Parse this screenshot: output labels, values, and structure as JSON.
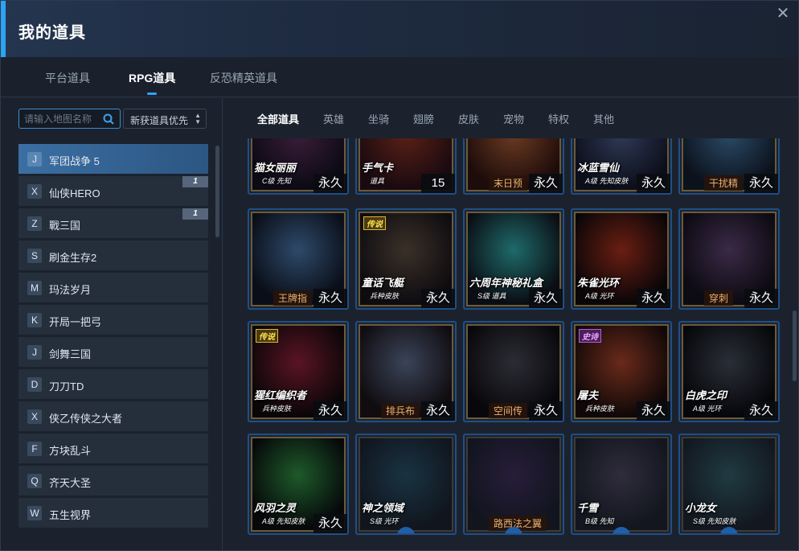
{
  "window": {
    "title": "我的道具",
    "close_icon": "close-icon"
  },
  "top_tabs": [
    {
      "label": "平台道具",
      "active": false
    },
    {
      "label": "RPG道具",
      "active": true
    },
    {
      "label": "反恐精英道具",
      "active": false
    }
  ],
  "search": {
    "placeholder": "请输入地图名称",
    "value": "",
    "icon": "search-icon"
  },
  "sort": {
    "label": "新获道具优先",
    "icon": "sort-arrows-icon"
  },
  "maps": [
    {
      "letter": "J",
      "name": "军团战争 5",
      "badge": "",
      "active": true
    },
    {
      "letter": "X",
      "name": "仙侠HERO",
      "badge": "1",
      "active": false
    },
    {
      "letter": "Z",
      "name": "戰三国",
      "badge": "1",
      "active": false
    },
    {
      "letter": "S",
      "name": "刷金生存2",
      "badge": "",
      "active": false
    },
    {
      "letter": "M",
      "name": "玛法岁月",
      "badge": "",
      "active": false
    },
    {
      "letter": "K",
      "name": "开局一把弓",
      "badge": "",
      "active": false
    },
    {
      "letter": "J",
      "name": "剑舞三国",
      "badge": "",
      "active": false
    },
    {
      "letter": "D",
      "name": "刀刀TD",
      "badge": "",
      "active": false
    },
    {
      "letter": "X",
      "name": "侠乙传侠之大者",
      "badge": "",
      "active": false
    },
    {
      "letter": "F",
      "name": "方块乱斗",
      "badge": "",
      "active": false
    },
    {
      "letter": "Q",
      "name": "齐天大圣",
      "badge": "",
      "active": false
    },
    {
      "letter": "W",
      "name": "五生视界",
      "badge": "",
      "active": false
    }
  ],
  "categories": [
    {
      "label": "全部道具",
      "active": true
    },
    {
      "label": "英雄",
      "active": false
    },
    {
      "label": "坐骑",
      "active": false
    },
    {
      "label": "翅膀",
      "active": false
    },
    {
      "label": "皮肤",
      "active": false
    },
    {
      "label": "宠物",
      "active": false
    },
    {
      "label": "特权",
      "active": false
    },
    {
      "label": "其他",
      "active": false
    }
  ],
  "rows": [
    [
      {
        "name": "猫女丽丽",
        "sub": "C级 先知",
        "plate": "",
        "dur": "永久",
        "tag": "",
        "locked": false,
        "colors": [
          "#3a1d3a",
          "#0c0a14"
        ]
      },
      {
        "name": "手气卡",
        "sub": "道具",
        "plate": "",
        "dur": "15",
        "tag": "",
        "locked": false,
        "colors": [
          "#5a2016",
          "#1a0a10"
        ]
      },
      {
        "name": "",
        "sub": "",
        "plate": "末日预",
        "dur": "永久",
        "tag": "",
        "locked": false,
        "colors": [
          "#6a3a22",
          "#1e0c0a"
        ]
      },
      {
        "name": "冰蓝雪仙",
        "sub": "A级 先知皮肤",
        "plate": "",
        "dur": "永久",
        "tag": "",
        "locked": false,
        "colors": [
          "#2f3a56",
          "#0c0e1a"
        ]
      },
      {
        "name": "",
        "sub": "",
        "plate": "干扰精",
        "dur": "永久",
        "tag": "",
        "locked": false,
        "colors": [
          "#2a4a66",
          "#0c121c"
        ]
      }
    ],
    [
      {
        "name": "",
        "sub": "",
        "plate": "王牌指",
        "dur": "永久",
        "tag": "",
        "locked": false,
        "colors": [
          "#2e4a6a",
          "#0a0e18"
        ]
      },
      {
        "name": "童话飞艇",
        "sub": "兵种皮肤",
        "plate": "",
        "dur": "永久",
        "tag": "传说",
        "locked": false,
        "colors": [
          "#3a3028",
          "#0e0c10"
        ]
      },
      {
        "name": "六周年神秘礼盒",
        "sub": "S级 道具",
        "plate": "",
        "dur": "永久",
        "tag": "",
        "locked": false,
        "colors": [
          "#1f6a6a",
          "#0a0e14"
        ]
      },
      {
        "name": "朱雀光环",
        "sub": "A级 光环",
        "plate": "",
        "dur": "永久",
        "tag": "",
        "locked": false,
        "colors": [
          "#6a1e12",
          "#0a0608"
        ]
      },
      {
        "name": "",
        "sub": "",
        "plate": "穿刺",
        "dur": "永久",
        "tag": "",
        "locked": false,
        "colors": [
          "#3a2a46",
          "#0c0a12"
        ]
      }
    ],
    [
      {
        "name": "猩红编织者",
        "sub": "兵种皮肤",
        "plate": "",
        "dur": "永久",
        "tag": "传说",
        "locked": false,
        "colors": [
          "#5a1424",
          "#0a0608"
        ]
      },
      {
        "name": "",
        "sub": "",
        "plate": "排兵布",
        "dur": "永久",
        "tag": "",
        "locked": false,
        "colors": [
          "#3a4458",
          "#100c10"
        ]
      },
      {
        "name": "",
        "sub": "",
        "plate": "空间传",
        "dur": "永久",
        "tag": "",
        "locked": false,
        "colors": [
          "#2c2c34",
          "#08080c"
        ]
      },
      {
        "name": "屠夫",
        "sub": "兵种皮肤",
        "plate": "",
        "dur": "永久",
        "tag": "史诗",
        "locked": false,
        "colors": [
          "#6a2a1a",
          "#100808"
        ]
      },
      {
        "name": "白虎之印",
        "sub": "A级 光环",
        "plate": "",
        "dur": "永久",
        "tag": "",
        "locked": false,
        "colors": [
          "#2a2e38",
          "#06070a"
        ]
      }
    ],
    [
      {
        "name": "风羽之灵",
        "sub": "A级 先知皮肤",
        "plate": "",
        "dur": "永久",
        "tag": "",
        "locked": false,
        "colors": [
          "#1e5a2a",
          "#06080a"
        ]
      },
      {
        "name": "神之领域",
        "sub": "S级 光环",
        "plate": "",
        "dur": "",
        "tag": "",
        "locked": true,
        "colors": [
          "#1a4a5a",
          "#06080c"
        ]
      },
      {
        "name": "",
        "sub": "",
        "plate": "路西法之翼",
        "dur": "",
        "tag": "",
        "locked": true,
        "colors": [
          "#3a1a4a",
          "#08060c"
        ]
      },
      {
        "name": "千雪",
        "sub": "B级 先知",
        "plate": "",
        "dur": "",
        "tag": "",
        "locked": true,
        "colors": [
          "#4a3a4e",
          "#0a080c"
        ]
      },
      {
        "name": "小龙女",
        "sub": "S级 先知皮肤",
        "plate": "",
        "dur": "",
        "tag": "",
        "locked": true,
        "colors": [
          "#2a5a5a",
          "#0a0c10"
        ]
      }
    ]
  ]
}
